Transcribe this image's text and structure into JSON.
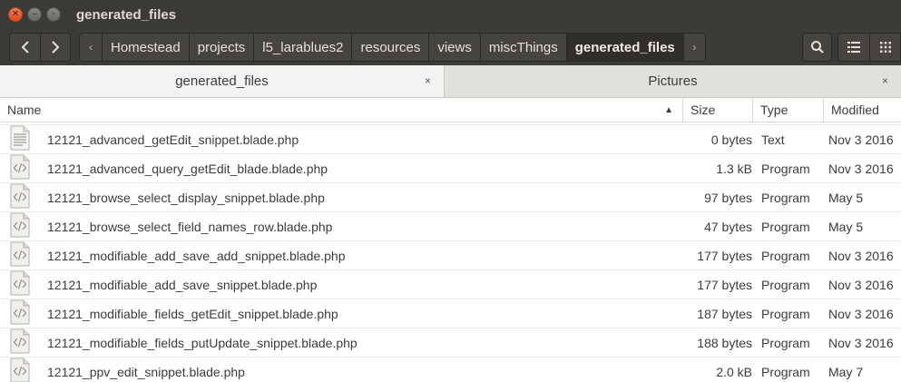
{
  "window": {
    "title": "generated_files",
    "controls": [
      "close-icon",
      "minimize-icon",
      "maximize-icon"
    ]
  },
  "toolbar": {
    "back_icon": "chevron-left-icon",
    "forward_icon": "chevron-right-icon",
    "breadcrumbs": [
      "Homestead",
      "projects",
      "l5_larablues2",
      "resources",
      "views",
      "miscThings",
      "generated_files"
    ],
    "active_crumb": "generated_files",
    "search_icon": "search-icon",
    "list_view_icon": "list-view-icon",
    "grid_view_icon": "grid-view-icon"
  },
  "tabs": [
    {
      "label": "generated_files",
      "close": "×"
    },
    {
      "label": "Pictures",
      "close": "×"
    }
  ],
  "columns": {
    "name": "Name",
    "size": "Size",
    "type": "Type",
    "modified": "Modified"
  },
  "files": [
    {
      "name": "12121_advanced_getEdit_snippet.blade.php",
      "size": "0 bytes",
      "type": "Text",
      "modified": "Nov 3 2016",
      "icon": "text-file-icon"
    },
    {
      "name": "12121_advanced_query_getEdit_blade.blade.php",
      "size": "1.3 kB",
      "type": "Program",
      "modified": "Nov 3 2016",
      "icon": "code-file-icon"
    },
    {
      "name": "12121_browse_select_display_snippet.blade.php",
      "size": "97 bytes",
      "type": "Program",
      "modified": "May 5",
      "icon": "code-file-icon"
    },
    {
      "name": "12121_browse_select_field_names_row.blade.php",
      "size": "47 bytes",
      "type": "Program",
      "modified": "May 5",
      "icon": "code-file-icon"
    },
    {
      "name": "12121_modifiable_add_save_add_snippet.blade.php",
      "size": "177 bytes",
      "type": "Program",
      "modified": "Nov 3 2016",
      "icon": "code-file-icon"
    },
    {
      "name": "12121_modifiable_add_save_snippet.blade.php",
      "size": "177 bytes",
      "type": "Program",
      "modified": "Nov 3 2016",
      "icon": "code-file-icon"
    },
    {
      "name": "12121_modifiable_fields_getEdit_snippet.blade.php",
      "size": "187 bytes",
      "type": "Program",
      "modified": "Nov 3 2016",
      "icon": "code-file-icon"
    },
    {
      "name": "12121_modifiable_fields_putUpdate_snippet.blade.php",
      "size": "188 bytes",
      "type": "Program",
      "modified": "Nov 3 2016",
      "icon": "code-file-icon"
    },
    {
      "name": "12121_ppv_edit_snippet.blade.php",
      "size": "2.0 kB",
      "type": "Program",
      "modified": "May 7",
      "icon": "code-file-icon"
    }
  ]
}
